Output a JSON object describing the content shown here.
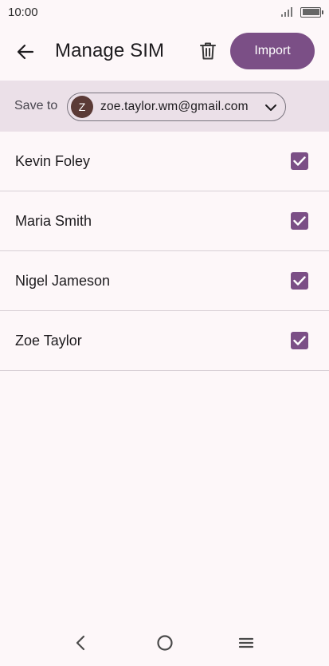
{
  "status_bar": {
    "time": "10:00"
  },
  "app_bar": {
    "title": "Manage SIM",
    "import_label": "Import",
    "back_icon": "arrow-left-icon",
    "delete_icon": "trash-icon"
  },
  "save_to": {
    "label": "Save to",
    "avatar_initial": "Z",
    "account_email": "zoe.taylor.wm@gmail.com"
  },
  "contacts": [
    {
      "name": "Kevin Foley",
      "checked": true
    },
    {
      "name": "Maria Smith",
      "checked": true
    },
    {
      "name": "Nigel Jameson",
      "checked": true
    },
    {
      "name": "Zoe Taylor",
      "checked": true
    }
  ],
  "nav": {
    "back_icon": "chevron-left-icon",
    "home_icon": "circle-home-icon",
    "menu_icon": "hamburger-menu-icon"
  },
  "colors": {
    "accent": "#7b4f86",
    "background": "#fdf7f9",
    "save_bar_bg": "#ebe0e8",
    "avatar_bg": "#5b3a36"
  }
}
